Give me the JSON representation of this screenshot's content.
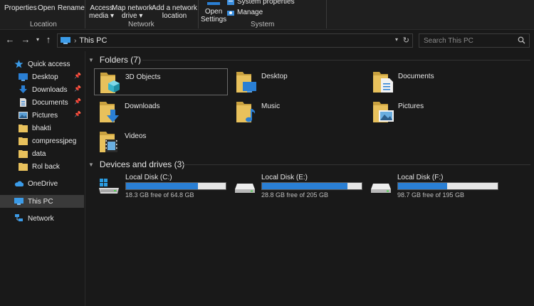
{
  "ribbon": {
    "location": {
      "properties": "Properties",
      "open": "Open",
      "rename": "Rename",
      "group": "Location"
    },
    "network": {
      "access_media_1": "Access",
      "access_media_2": "media",
      "map_drive_1": "Map network",
      "map_drive_2": "drive",
      "add_location_1": "Add a network",
      "add_location_2": "location",
      "group": "Network"
    },
    "system": {
      "open_settings_1": "Open",
      "open_settings_2": "Settings",
      "system_properties": "System properties",
      "manage": "Manage",
      "group": "System"
    }
  },
  "address": {
    "path": "This PC",
    "search_placeholder": "Search This PC"
  },
  "sidebar": {
    "quick_access": "Quick access",
    "items": [
      "Desktop",
      "Downloads",
      "Documents",
      "Pictures",
      "bhakti",
      "compressjpeg",
      "data",
      "Rol back"
    ],
    "onedrive": "OneDrive",
    "this_pc": "This PC",
    "network": "Network"
  },
  "folders": {
    "header": "Folders (7)",
    "items": [
      "3D Objects",
      "Desktop",
      "Documents",
      "Downloads",
      "Music",
      "Pictures",
      "Videos"
    ]
  },
  "drives": {
    "header": "Devices and drives (3)",
    "items": [
      {
        "name": "Local Disk (C:)",
        "free": "18.3 GB free of 64.8 GB",
        "used_fraction": 0.72
      },
      {
        "name": "Local Disk (E:)",
        "free": "28.8 GB free of 205 GB",
        "used_fraction": 0.86
      },
      {
        "name": "Local Disk (F:)",
        "free": "98.7 GB free of 195 GB",
        "used_fraction": 0.49
      }
    ]
  },
  "colors": {
    "accent": "#2a7fd4",
    "folder": "#e8c15c",
    "background": "#191919"
  }
}
